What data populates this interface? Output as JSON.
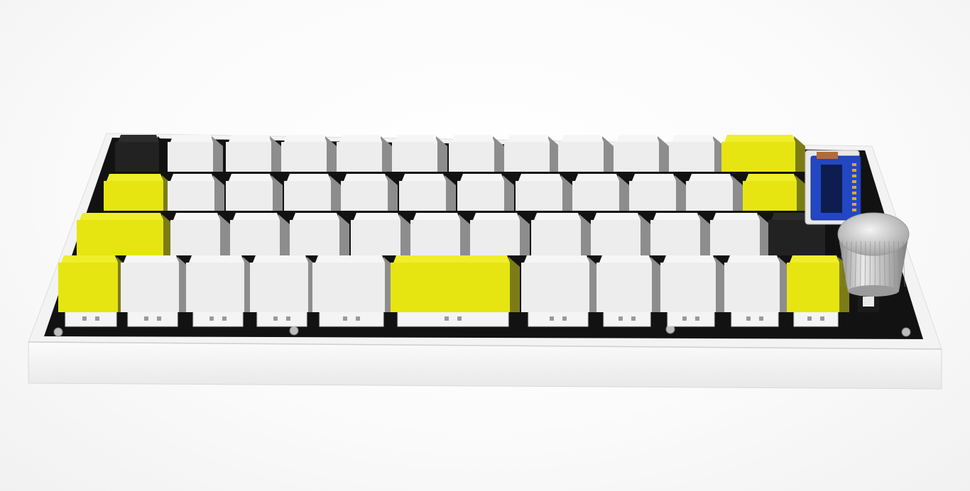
{
  "scene": {
    "subject": "keyboard",
    "colors": {
      "background": "#fafafa",
      "case": "#f2f2f2",
      "plate": "#141414",
      "keycap_white": "#ededed",
      "keycap_yellow": "#e6e512",
      "keycap_black": "#222222",
      "display_blue": "#1f3fb0",
      "knob": "#c9c9c9"
    },
    "layout": {
      "rows": [
        [
          "black",
          "white",
          "white",
          "white",
          "white",
          "white",
          "white",
          "white",
          "white",
          "white",
          "white",
          "yellow"
        ],
        [
          "yellow",
          "white",
          "white",
          "white",
          "white",
          "white",
          "white",
          "white",
          "white",
          "white",
          "white",
          "yellow"
        ],
        [
          "yellow",
          "white",
          "white",
          "white",
          "white",
          "white",
          "white",
          "white",
          "white",
          "white",
          "white",
          "black"
        ],
        [
          "yellow",
          "white",
          "white",
          "white",
          "white",
          "yellow",
          "white",
          "white",
          "white",
          "white",
          "yellow"
        ]
      ]
    },
    "accessories": [
      "oled-display-icon",
      "rotary-knob-icon"
    ]
  }
}
